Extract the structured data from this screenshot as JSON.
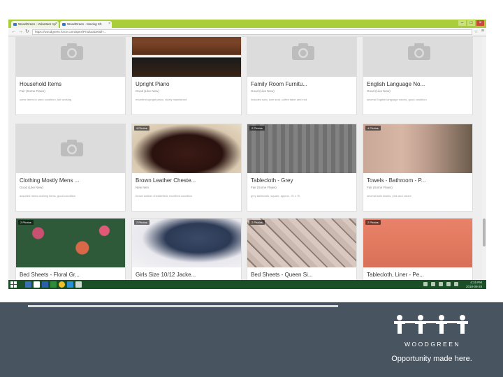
{
  "browser": {
    "tabs": [
      {
        "label": "WoodGreen - Volunteer Ap"
      },
      {
        "label": "WoodGreen - Moving Sh"
      }
    ],
    "url": "https://woodgreen.force.com/apex/ProductDetail?...",
    "controls": {
      "minimize": "–",
      "maximize": "□",
      "close": "×"
    },
    "nav": {
      "back": "←",
      "forward": "→",
      "reload": "↻"
    }
  },
  "items": [
    {
      "title": "Household Items",
      "subtitle": "Fair (Some Flaws)",
      "desc": "some items in used condition, fair working",
      "badge": "",
      "has_photo": false
    },
    {
      "title": "Upright Piano",
      "subtitle": "Good (Like New)",
      "desc": "excellent upright piano, nicely maintained",
      "badge": "",
      "has_photo": true
    },
    {
      "title": "Family Room Furnitu...",
      "subtitle": "Good (Like New)",
      "desc": "Includes sofa, love seat, coffee table and end",
      "badge": "",
      "has_photo": false
    },
    {
      "title": "English Language No...",
      "subtitle": "Good (Like New)",
      "desc": "several English language novels, good condition",
      "badge": "",
      "has_photo": false
    },
    {
      "title": "Clothing Mostly Mens ...",
      "subtitle": "Good (Like New)",
      "desc": "assorted mens clothing items, good condition",
      "badge": "",
      "has_photo": false
    },
    {
      "title": "Brown Leather Cheste...",
      "subtitle": "New Item",
      "desc": "brown leather chesterfield, excellent condition",
      "badge": "4 Photos",
      "has_photo": true
    },
    {
      "title": "Tablecloth - Grey",
      "subtitle": "Fair (Some Flaws)",
      "desc": "grey tablecloth, square, approx. 70 x 70",
      "badge": "2 Photos",
      "has_photo": true
    },
    {
      "title": "Towels - Bathroom - P...",
      "subtitle": "Fair (Some Flaws)",
      "desc": "several bath towels, pink and cream",
      "badge": "4 Photos",
      "has_photo": true
    },
    {
      "title": "Bed Sheets - Floral Gr...",
      "subtitle": "",
      "desc": "",
      "badge": "2 Photos",
      "has_photo": true
    },
    {
      "title": "Girls Size 10/12 Jacke...",
      "subtitle": "",
      "desc": "",
      "badge": "2 Photos",
      "has_photo": true
    },
    {
      "title": "Bed Sheets - Queen Si...",
      "subtitle": "",
      "desc": "",
      "badge": "2 Photos",
      "has_photo": true
    },
    {
      "title": "Tablecloth, Liner - Pe...",
      "subtitle": "",
      "desc": "",
      "badge": "2 Photos",
      "has_photo": true
    }
  ],
  "taskbar": {
    "time": "4:15 PM",
    "date": "2018-09-28",
    "lang": "ENG US"
  },
  "footer": {
    "logo_text": "WOODGREEN",
    "tagline": "Opportunity made here."
  },
  "colors": {
    "browser_green": "#a9ce3a",
    "taskbar_green": "#1b4f28",
    "footer_slate": "#48545f"
  }
}
